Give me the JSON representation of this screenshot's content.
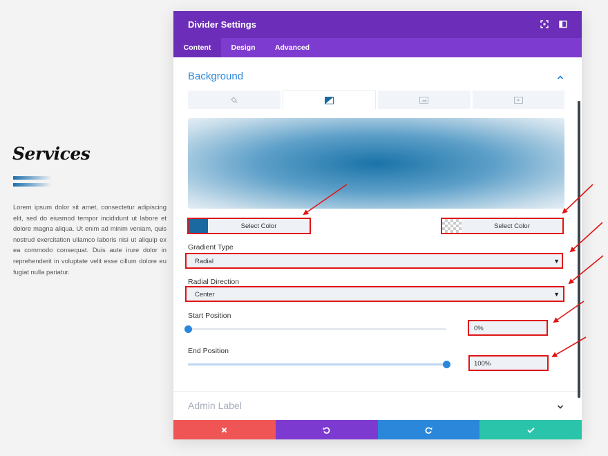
{
  "page": {
    "title": "Services",
    "body": "Lorem ipsum dolor sit amet, consectetur adipiscing elit, sed do eiusmod tempor incididunt ut labore et dolore magna aliqua. Ut enim ad minim veniam, quis nostrud exercitation ullamco laboris nisi ut aliquip ex ea commodo consequat. Duis aute irure dolor in reprehenderit in voluptate velit esse cillum dolore eu fugiat nulla pariatur."
  },
  "modal": {
    "title": "Divider Settings",
    "tabs": [
      {
        "label": "Content",
        "active": true
      },
      {
        "label": "Design",
        "active": false
      },
      {
        "label": "Advanced",
        "active": false
      }
    ]
  },
  "background": {
    "section_title": "Background",
    "type_tabs": [
      "color-icon",
      "gradient-icon",
      "image-icon",
      "video-icon"
    ],
    "active_type": "gradient-icon",
    "gradient_colors": [
      "#1a6aa1",
      "#ffffff"
    ],
    "color1": {
      "label": "Select Color",
      "swatch": "#1a6aa1"
    },
    "color2": {
      "label": "Select Color",
      "swatch": "transparent"
    },
    "gradient_type": {
      "label": "Gradient Type",
      "value": "Radial"
    },
    "radial_direction": {
      "label": "Radial Direction",
      "value": "Center"
    },
    "start_position": {
      "label": "Start Position",
      "value": "0%",
      "fraction": 0.0
    },
    "end_position": {
      "label": "End Position",
      "value": "100%",
      "fraction": 1.0
    }
  },
  "admin_label": {
    "title": "Admin Label"
  },
  "footer": {
    "buttons": [
      "cancel",
      "undo",
      "redo",
      "save"
    ],
    "colors": {
      "cancel": "#ef5555",
      "undo": "#7d3ad0",
      "redo": "#2b87da",
      "save": "#29c4a9"
    }
  },
  "colors": {
    "header": "#6c2eb9",
    "tabs": "#7e3bd0",
    "accent": "#2b87da",
    "annotation": "#e01414"
  }
}
